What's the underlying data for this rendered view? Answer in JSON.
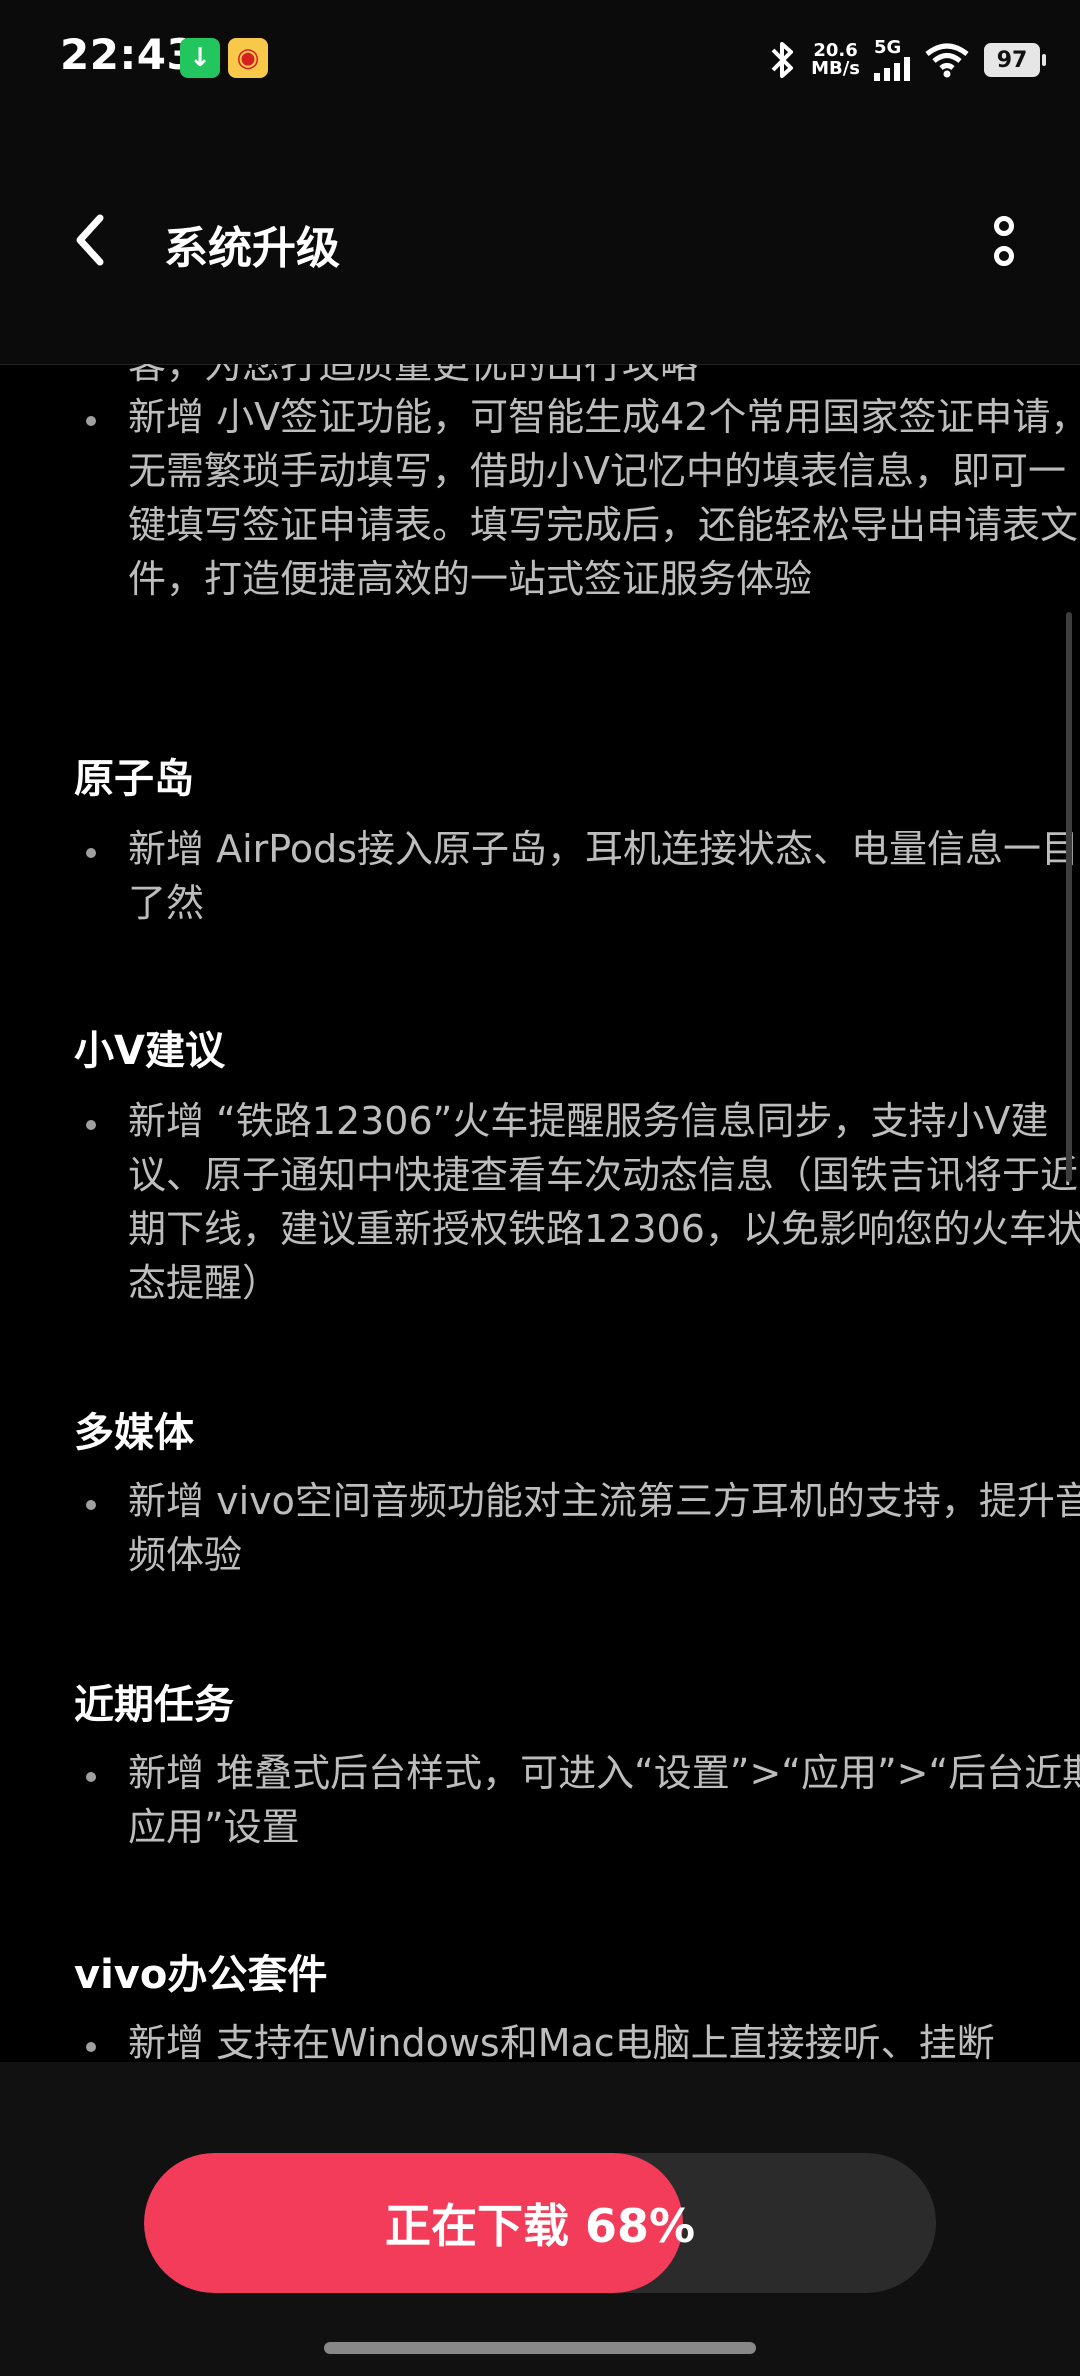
{
  "status_bar": {
    "time": "22:43",
    "notifications": [
      "download-icon",
      "weibo-icon"
    ],
    "net_speed_value": "20.6",
    "net_speed_unit": "MB/s",
    "network": "5G",
    "battery": "97"
  },
  "header": {
    "title": "系统升级",
    "back_icon": "chevron-left-icon",
    "more_icon": "more-vertical-icon"
  },
  "content": {
    "cut_off_line": "客，为您打造质量更优的出行攻略",
    "visa_item": "新增 小V签证功能，可智能生成42个常用国家签证申请，无需繁琐手动填写，借助小V记忆中的填表信息，即可一键填写签证申请表。填写完成后，还能轻松导出申请表文件，打造便捷高效的一站式签证服务体验",
    "sections": [
      {
        "title": "原子岛",
        "item": "新增 AirPods接入原子岛，耳机连接状态、电量信息一目了然"
      },
      {
        "title": "小V建议",
        "item": "新增 “铁路12306”火车提醒服务信息同步，支持小V建议、原子通知中快捷查看车次动态信息（国铁吉讯将于近期下线，建议重新授权铁路12306，以免影响您的火车状态提醒）"
      },
      {
        "title": "多媒体",
        "item": "新增 vivo空间音频功能对主流第三方耳机的支持，提升音频体验"
      },
      {
        "title": "近期任务",
        "item": "新增 堆叠式后台样式，可进入“设置”>“应用”>“后台近期应用”设置"
      },
      {
        "title": "vivo办公套件",
        "item": "新增 支持在Windows和Mac电脑上直接接听、挂断"
      }
    ]
  },
  "download": {
    "label": "正在下载 68%",
    "progress": 0.68,
    "accent_color": "#f33c5a"
  }
}
